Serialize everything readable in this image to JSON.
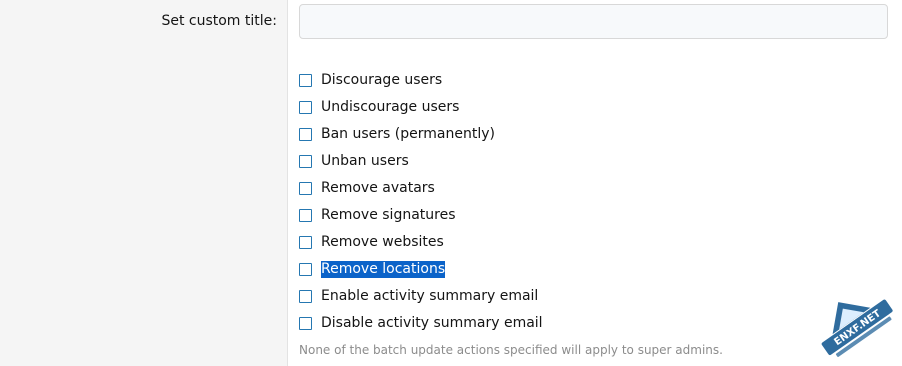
{
  "form": {
    "custom_title_label": "Set custom title:",
    "custom_title_value": "",
    "custom_title_placeholder": ""
  },
  "actions": [
    {
      "label": "Discourage users",
      "checked": false,
      "selected_text": false
    },
    {
      "label": "Undiscourage users",
      "checked": false,
      "selected_text": false
    },
    {
      "label": "Ban users (permanently)",
      "checked": false,
      "selected_text": false
    },
    {
      "label": "Unban users",
      "checked": false,
      "selected_text": false
    },
    {
      "label": "Remove avatars",
      "checked": false,
      "selected_text": false
    },
    {
      "label": "Remove signatures",
      "checked": false,
      "selected_text": false
    },
    {
      "label": "Remove websites",
      "checked": false,
      "selected_text": false
    },
    {
      "label": "Remove locations",
      "checked": false,
      "selected_text": true
    },
    {
      "label": "Enable activity summary email",
      "checked": false,
      "selected_text": false
    },
    {
      "label": "Disable activity summary email",
      "checked": false,
      "selected_text": false
    }
  ],
  "hint": "None of the batch update actions specified will apply to super admins.",
  "watermark": {
    "brand": "ENXF.NET",
    "colors": {
      "accent": "#1d5f96",
      "light": "#e8f2fb"
    }
  },
  "colors": {
    "label_column_bg": "#f5f5f5",
    "checkbox_border": "#2577b1",
    "selection_bg": "#0b63c9",
    "hint_text": "#8c8c8c"
  }
}
